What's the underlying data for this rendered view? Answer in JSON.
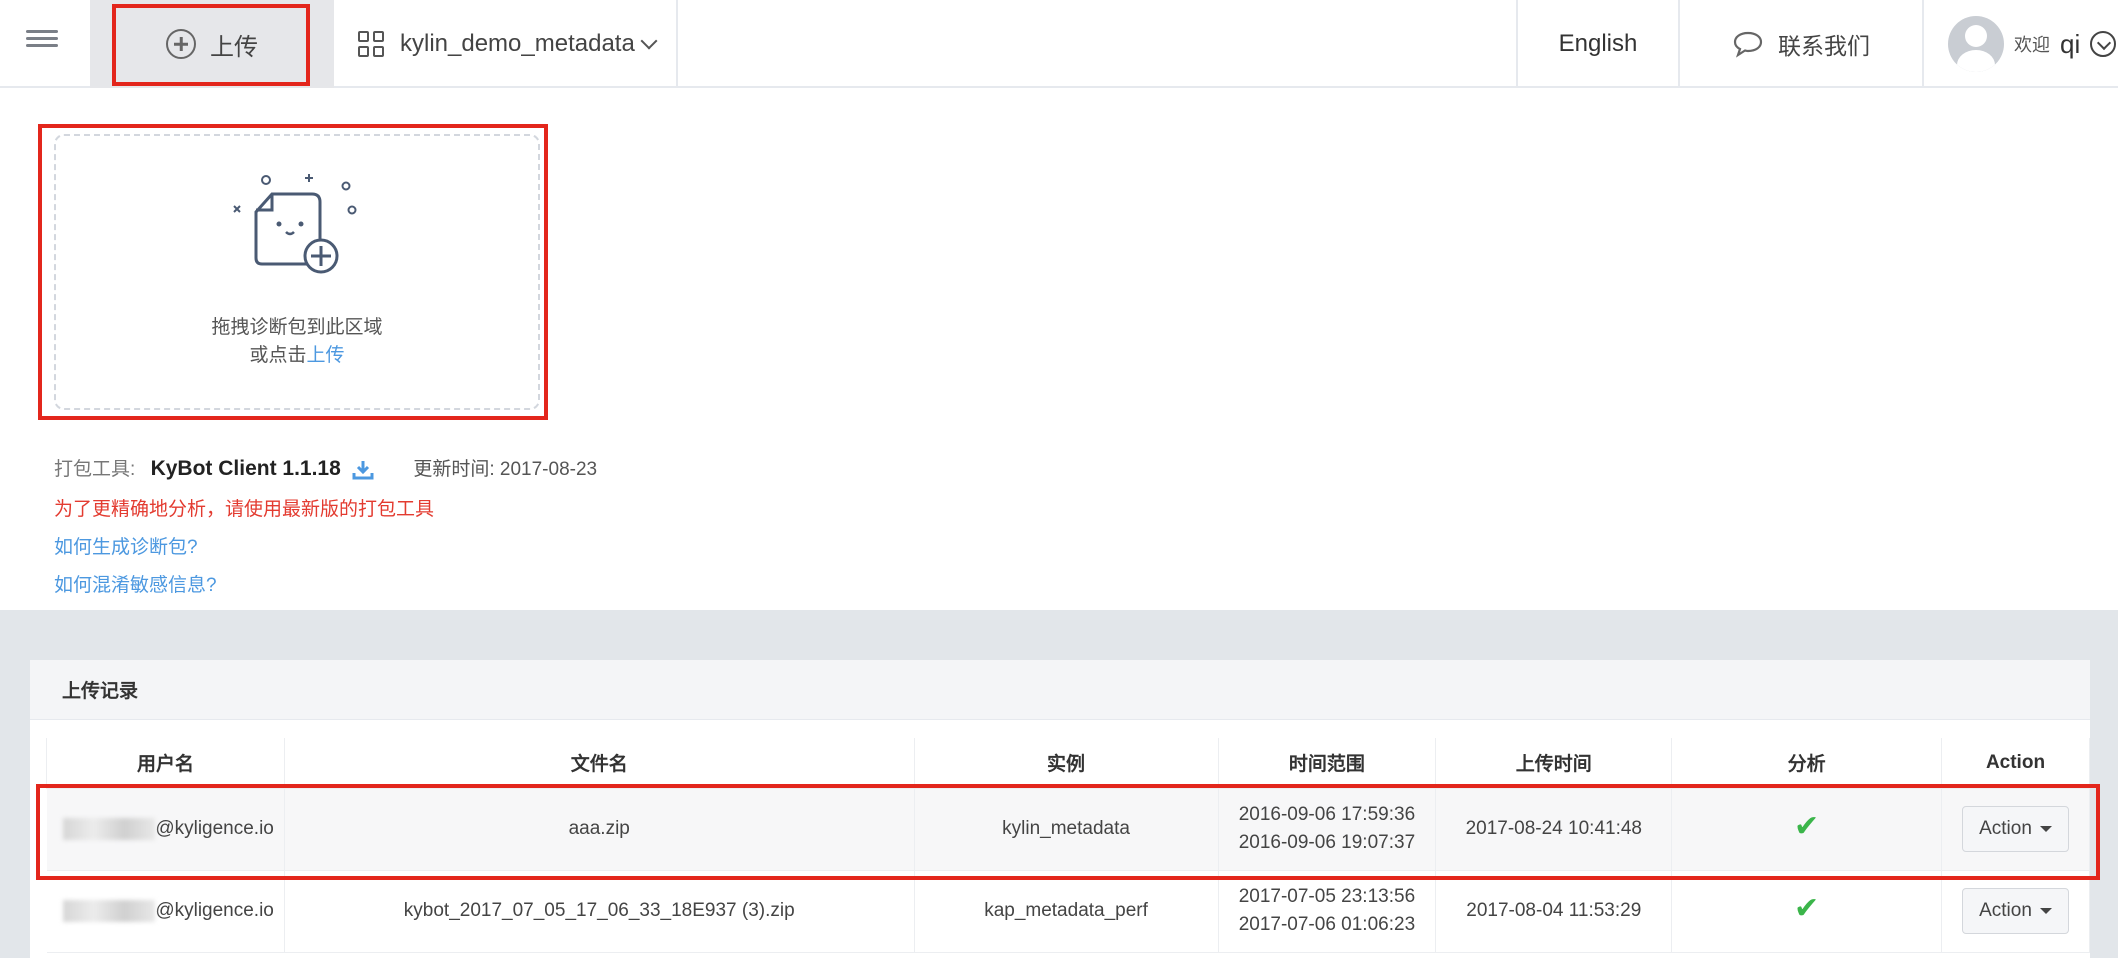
{
  "topbar": {
    "upload_label": "上传",
    "project_name": "kylin_demo_metadata",
    "language": "English",
    "contact_label": "联系我们",
    "welcome": "欢迎",
    "username": "qi"
  },
  "dropzone": {
    "line1": "拖拽诊断包到此区域",
    "line2_prefix": "或点击",
    "line2_link": "上传"
  },
  "tool": {
    "label": "打包工具:",
    "name": "KyBot Client 1.1.18",
    "update_label": "更新时间: 2017-08-23",
    "warning": "为了更精确地分析，请使用最新版的打包工具",
    "link1": "如何生成诊断包?",
    "link2": "如何混淆敏感信息?"
  },
  "records": {
    "title": "上传记录",
    "columns": [
      "用户名",
      "文件名",
      "实例",
      "时间范围",
      "上传时间",
      "分析",
      "Action"
    ],
    "rows": [
      {
        "user_suffix": "@kyligence.io",
        "file": "aaa.zip",
        "instance": "kylin_metadata",
        "range_start": "2016-09-06 17:59:36",
        "range_end": "2016-09-06 19:07:37",
        "uploaded": "2017-08-24 10:41:48",
        "analysis": "✔",
        "action": "Action"
      },
      {
        "user_suffix": "@kyligence.io",
        "file": "kybot_2017_07_05_17_06_33_18E937 (3).zip",
        "instance": "kap_metadata_perf",
        "range_start": "2017-07-05 23:13:56",
        "range_end": "2017-07-06 01:06:23",
        "uploaded": "2017-08-04 11:53:29",
        "analysis": "✔",
        "action": "Action"
      }
    ]
  },
  "colors": {
    "highlight": "#e3261c",
    "link": "#4c98e0",
    "warning": "#e33b30",
    "success": "#3bb54a"
  }
}
